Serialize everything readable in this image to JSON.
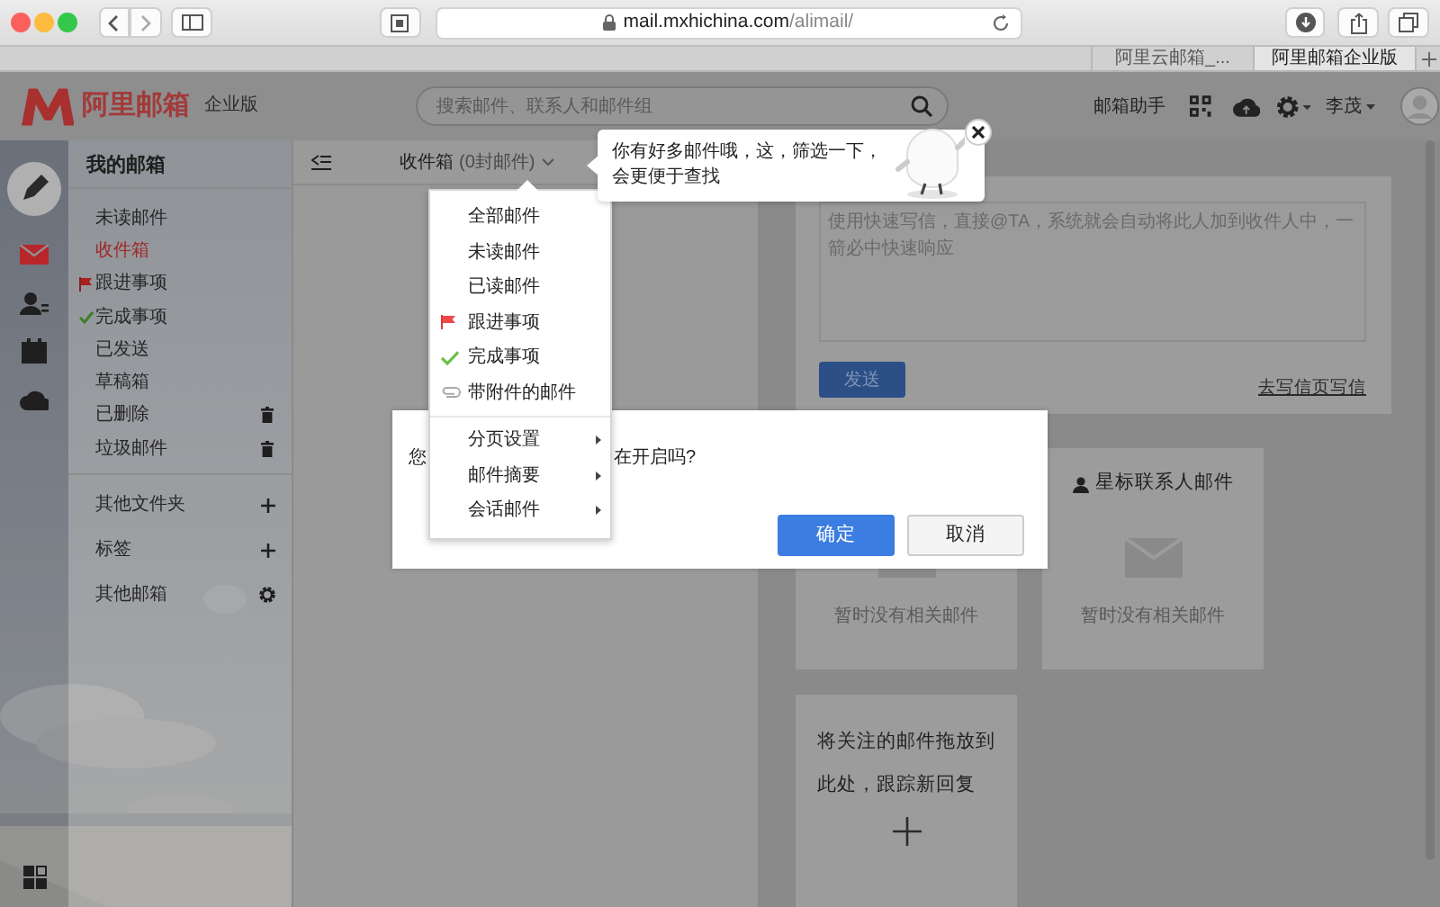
{
  "browser": {
    "url_host": "mail.mxhichina.com",
    "url_path": "/alimail/",
    "tabs": [
      {
        "label": "阿里云邮箱_...",
        "selected": false
      },
      {
        "label": "阿里邮箱企业版",
        "selected": true
      }
    ]
  },
  "header": {
    "logo": "阿里邮箱",
    "edition": "企业版",
    "search": {
      "placeholder": "搜索邮件、联系人和邮件组"
    },
    "assistant": "邮箱助手",
    "user": "李茂"
  },
  "rail": [
    {
      "kind": "mail",
      "selected": true
    },
    {
      "kind": "contacts",
      "selected": false
    },
    {
      "kind": "calendar",
      "selected": false
    },
    {
      "kind": "cloud",
      "selected": false
    }
  ],
  "folders": {
    "title": "我的邮箱",
    "items": [
      {
        "label": "未读邮件",
        "kind": "plain",
        "selected": false
      },
      {
        "label": "收件箱",
        "kind": "plain",
        "selected": true
      },
      {
        "label": "跟进事项",
        "kind": "flag",
        "selected": false
      },
      {
        "label": "完成事项",
        "kind": "check",
        "selected": false
      },
      {
        "label": "已发送",
        "kind": "plain",
        "selected": false
      },
      {
        "label": "草稿箱",
        "kind": "plain",
        "selected": false
      },
      {
        "label": "已删除",
        "kind": "trash",
        "selected": false
      },
      {
        "label": "垃圾邮件",
        "kind": "trash",
        "selected": false
      }
    ],
    "sections": [
      {
        "label": "其他文件夹",
        "kind": "add"
      },
      {
        "label": "标签",
        "kind": "add"
      },
      {
        "label": "其他邮箱",
        "kind": "settings"
      }
    ]
  },
  "mail_list": {
    "title": "收件箱",
    "count": "(0封邮件)"
  },
  "compose": {
    "placeholder": "使用快速写信，直接@TA，系统就会自动将此人加到收件人中，一箭必中快速响应",
    "send": "发送",
    "link": "去写信页写信"
  },
  "widgets": [
    {
      "kind": "empty",
      "empty_text": "暂时没有相关邮件"
    },
    {
      "kind": "empty",
      "title": "星标联系人邮件",
      "empty_text": "暂时没有相关邮件"
    },
    {
      "kind": "drop",
      "title": "将关注的邮件拖放到此处，跟踪新回复"
    }
  ],
  "dialog": {
    "text_parts": [
      "您",
      "在开启吗?"
    ],
    "confirm": "确定",
    "cancel": "取消"
  },
  "filter_menu": {
    "items": [
      {
        "label": "全部邮件",
        "kind": "plain"
      },
      {
        "label": "未读邮件",
        "kind": "plain"
      },
      {
        "label": "已读邮件",
        "kind": "plain"
      },
      {
        "label": "跟进事项",
        "kind": "flag"
      },
      {
        "label": "完成事项",
        "kind": "check"
      },
      {
        "label": "带附件的邮件",
        "kind": "attachment"
      },
      {
        "label": "分页设置",
        "kind": "submenu"
      },
      {
        "label": "邮件摘要",
        "kind": "submenu"
      },
      {
        "label": "会话邮件",
        "kind": "submenu"
      }
    ]
  },
  "tip": {
    "text": "你有好多邮件哦，这，筛选一下，会更便于查找"
  }
}
